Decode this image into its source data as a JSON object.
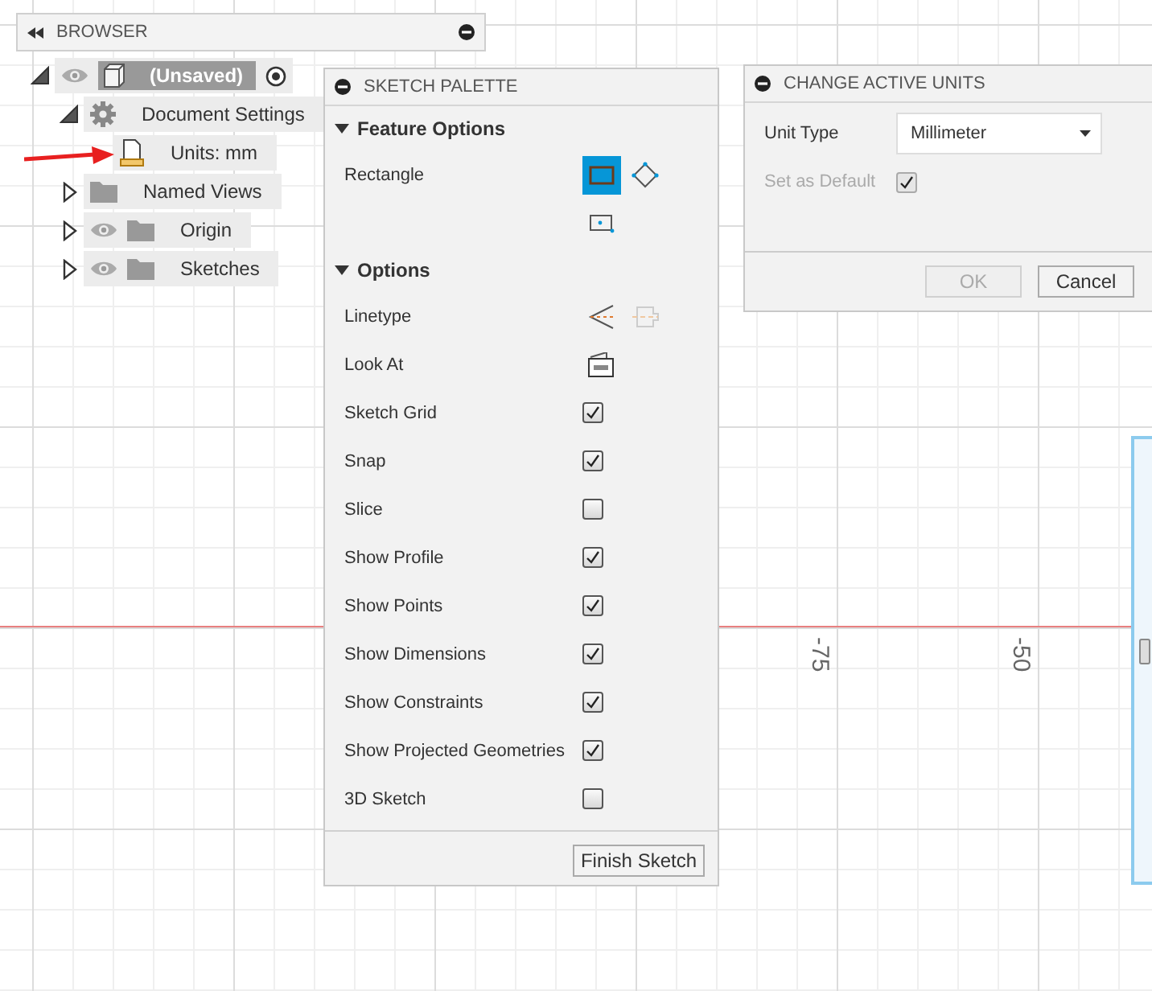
{
  "canvas": {
    "axis_labels": [
      "-75",
      "-50"
    ]
  },
  "browser": {
    "title": "BROWSER",
    "tree": [
      {
        "label": "(Unsaved)",
        "kind": "component",
        "expanded": true,
        "visible": true,
        "active": true,
        "children": [
          {
            "label": "Document Settings",
            "kind": "settings",
            "expanded": true,
            "visible": false,
            "children": [
              {
                "label": "Units: mm",
                "kind": "units",
                "visible": false
              }
            ]
          },
          {
            "label": "Named Views",
            "kind": "folder",
            "expanded": false,
            "visible": false
          },
          {
            "label": "Origin",
            "kind": "folder",
            "expanded": false,
            "visible": true
          },
          {
            "label": "Sketches",
            "kind": "folder",
            "expanded": false,
            "visible": true
          }
        ]
      }
    ]
  },
  "sketch_palette": {
    "title": "SKETCH PALETTE",
    "sections": [
      {
        "title": "Feature Options",
        "expanded": true,
        "rows": [
          {
            "label": "Rectangle",
            "kind": "tools",
            "tools": [
              {
                "selected": true
              },
              {
                "selected": false
              },
              {
                "selected": false
              }
            ]
          }
        ]
      },
      {
        "title": "Options",
        "expanded": true,
        "rows": [
          {
            "label": "Linetype",
            "kind": "tools",
            "tools": [
              {
                "selected": false
              },
              {
                "selected": false,
                "disabled": true
              }
            ]
          },
          {
            "label": "Look At",
            "kind": "action"
          },
          {
            "label": "Sketch Grid",
            "kind": "checkbox",
            "checked": true
          },
          {
            "label": "Snap",
            "kind": "checkbox",
            "checked": true
          },
          {
            "label": "Slice",
            "kind": "checkbox",
            "checked": false
          },
          {
            "label": "Show Profile",
            "kind": "checkbox",
            "checked": true
          },
          {
            "label": "Show Points",
            "kind": "checkbox",
            "checked": true
          },
          {
            "label": "Show Dimensions",
            "kind": "checkbox",
            "checked": true
          },
          {
            "label": "Show Constraints",
            "kind": "checkbox",
            "checked": true
          },
          {
            "label": "Show Projected Geometries",
            "kind": "checkbox",
            "checked": true
          },
          {
            "label": "3D Sketch",
            "kind": "checkbox",
            "checked": false
          }
        ]
      }
    ],
    "finish_button": "Finish Sketch"
  },
  "units_dialog": {
    "title": "CHANGE ACTIVE UNITS",
    "unit_type": {
      "label": "Unit Type",
      "value": "Millimeter"
    },
    "set_default": {
      "label": "Set as Default",
      "checked": true,
      "disabled": true
    },
    "buttons": [
      {
        "label": "OK",
        "disabled": true
      },
      {
        "label": "Cancel",
        "disabled": false
      }
    ]
  }
}
